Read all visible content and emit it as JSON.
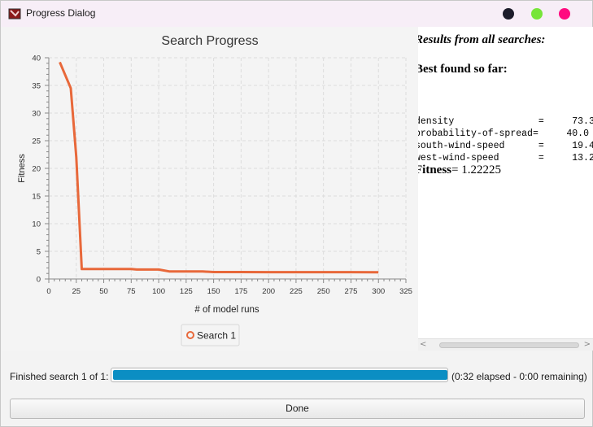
{
  "window": {
    "title": "Progress Dialog",
    "app_icon": "app-logo-icon",
    "buttons": {
      "minimize": "#1c1c2a",
      "maximize": "#77e53a",
      "close": "#ff0a7f"
    }
  },
  "chart_data": {
    "type": "line",
    "title": "Search Progress",
    "xlabel": "# of model runs",
    "ylabel": "Fitness",
    "xlim": [
      0,
      325
    ],
    "ylim": [
      0,
      40
    ],
    "xticks": [
      0,
      25,
      50,
      75,
      100,
      125,
      150,
      175,
      200,
      225,
      250,
      275,
      300,
      325
    ],
    "yticks": [
      0,
      5,
      10,
      15,
      20,
      25,
      30,
      35,
      40
    ],
    "grid": true,
    "legend_placement": "bottom-center",
    "series": [
      {
        "name": "Search 1",
        "color": "#e8683a",
        "x": [
          10,
          20,
          25,
          30,
          35,
          50,
          60,
          75,
          80,
          90,
          100,
          110,
          120,
          125,
          140,
          150,
          175,
          200,
          225,
          250,
          275,
          300
        ],
        "y": [
          39.2,
          34.5,
          22.0,
          1.8,
          1.8,
          1.8,
          1.8,
          1.8,
          1.7,
          1.7,
          1.7,
          1.35,
          1.35,
          1.35,
          1.35,
          1.25,
          1.25,
          1.24,
          1.24,
          1.23,
          1.23,
          1.22
        ]
      }
    ]
  },
  "results": {
    "heading_all": "Results from all searches:",
    "heading_best": "Best found so far:",
    "params": [
      {
        "name": "density",
        "eq": "=",
        "value": "73.3"
      },
      {
        "name": "probability-of-spread",
        "eq": "=",
        "value": "40.0"
      },
      {
        "name": "south-wind-speed",
        "eq": "=",
        "value": "19.4"
      },
      {
        "name": "west-wind-speed",
        "eq": "=",
        "value": "13.2"
      }
    ],
    "fitness_label": "Fitness",
    "fitness_value": "= 1.22225"
  },
  "status": {
    "label": "Finished search 1 of 1:",
    "progress": 1.0,
    "progress_color": "#0b8ec3",
    "elapsed_text": "(0:32 elapsed - 0:00 remaining)"
  },
  "done_button": "Done"
}
